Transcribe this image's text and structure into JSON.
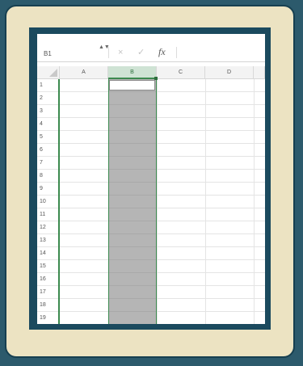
{
  "formula_bar": {
    "name_box": "B1",
    "spinner": "▲▼",
    "cancel_icon": "×",
    "enter_icon": "✓",
    "fx_label": "fx"
  },
  "columns": [
    "A",
    "B",
    "C",
    "D"
  ],
  "selected_column": "B",
  "active_cell": "B1",
  "rows": [
    "1",
    "2",
    "3",
    "4",
    "5",
    "6",
    "7",
    "8",
    "9",
    "10",
    "11",
    "12",
    "13",
    "14",
    "15",
    "16",
    "17",
    "18",
    "19"
  ],
  "colors": {
    "background": "#2c5a6c",
    "card": "#ece3c2",
    "frame": "#1b4a5e",
    "selection_fill": "#b5b5b5",
    "accent_green": "#3c8a4f"
  }
}
